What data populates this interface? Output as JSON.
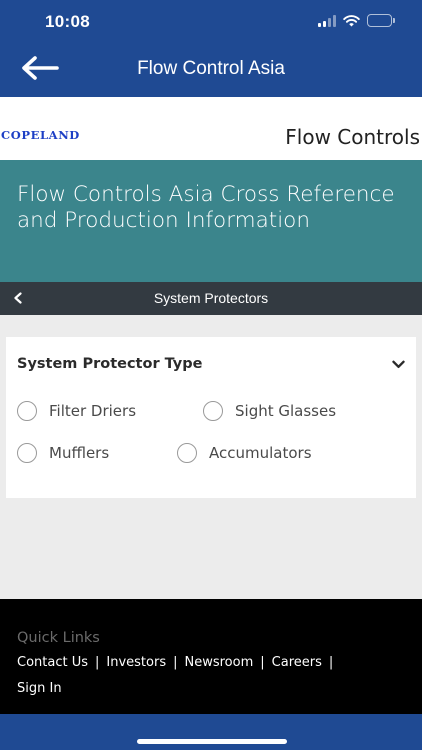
{
  "status_bar": {
    "time": "10:08",
    "battery_level": 0.35,
    "battery_color": "#ffd60a",
    "icons": [
      "signal-icon",
      "wifi-icon",
      "battery-icon"
    ]
  },
  "header": {
    "title": "Flow Control Asia",
    "back_icon": "arrow-left-icon",
    "background": "#1f4a93"
  },
  "brand": {
    "logo_text": "COPELAND",
    "logo_color": "#1d3fc5",
    "section_title": "Flow Controls"
  },
  "hero": {
    "title": "Flow Controls Asia Cross Reference and Production Information",
    "background": "#3b858c"
  },
  "subnav": {
    "title": "System Protectors",
    "back_icon": "chevron-left-icon"
  },
  "filter_card": {
    "title": "System Protector Type",
    "toggle_icon": "chevron-down-icon",
    "options": [
      {
        "label": "Filter Driers",
        "selected": false
      },
      {
        "label": "Sight Glasses",
        "selected": false
      },
      {
        "label": "Mufflers",
        "selected": false
      },
      {
        "label": "Accumulators",
        "selected": false
      }
    ]
  },
  "footer": {
    "quick_links_title": "Quick Links",
    "links": [
      "Contact Us",
      "Investors",
      "Newsroom",
      "Careers",
      "Sign In"
    ],
    "separator": "|"
  }
}
